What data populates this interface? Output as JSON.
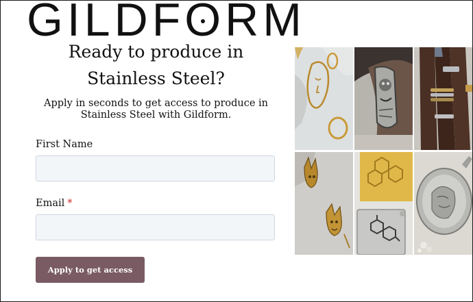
{
  "logo": {
    "part1": "GILDF",
    "part2": "O",
    "part3": "RM"
  },
  "form": {
    "headline_line1": "Ready to produce in",
    "headline_line2": "Stainless Steel?",
    "subtext": "Apply in seconds to get access to produce in Stainless Steel with Gildform.",
    "first_name_label": "First Name",
    "first_name_value": "",
    "email_label": "Email",
    "email_required_marker": "*",
    "email_value": "",
    "submit_label": "Apply to get access"
  },
  "colors": {
    "submit_button": "#7a5b63",
    "input_background": "#f3f6f9",
    "required_marker": "#d0342c"
  },
  "gallery": {
    "images": [
      "face-earring-jewelry",
      "carved-silver-ring-on-finger",
      "stacked-rings-on-hand",
      "gold-devil-pendants",
      "molecule-pendants",
      "engraved-silver-medallion"
    ]
  }
}
